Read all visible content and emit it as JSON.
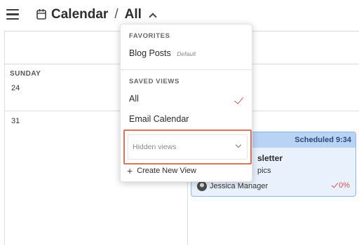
{
  "header": {
    "title": "Calendar",
    "separator": "/",
    "current_view": "All"
  },
  "calendar": {
    "day_name": "SUNDAY",
    "dates": [
      "24",
      "31"
    ]
  },
  "event": {
    "status": "Scheduled 9:34",
    "title_fragment": "sletter",
    "subtitle_fragment": "pics",
    "assignee": "Jessica Manager",
    "progress": "0%"
  },
  "dropdown": {
    "favorites_heading": "FAVORITES",
    "favorites": [
      {
        "label": "Blog Posts",
        "tag": "Default"
      }
    ],
    "saved_heading": "SAVED VIEWS",
    "saved_views": [
      {
        "label": "All",
        "selected": true
      },
      {
        "label": "Email Calendar",
        "selected": false
      }
    ],
    "hidden_views_label": "Hidden views",
    "create_label": "Create New View"
  },
  "colors": {
    "accent": "#d9534f",
    "highlight_border": "#d9745c",
    "event_bg": "#e8f1fc",
    "event_header": "#b9d3f5"
  }
}
